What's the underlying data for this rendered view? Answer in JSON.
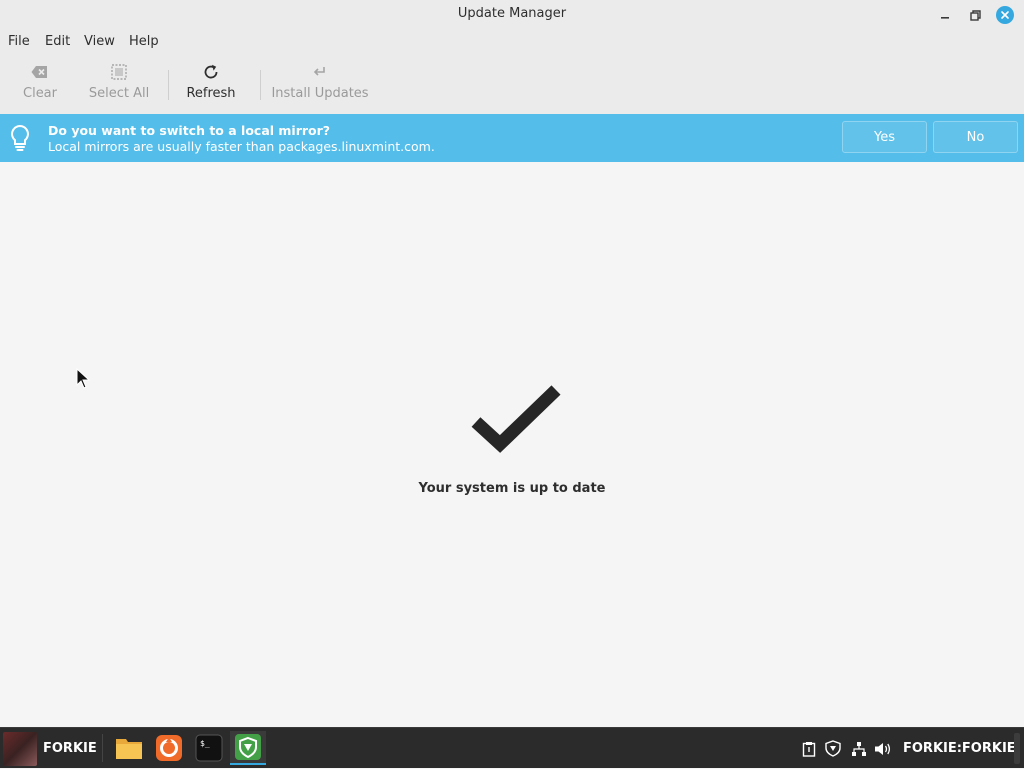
{
  "window": {
    "title": "Update Manager"
  },
  "menubar": {
    "items": [
      "File",
      "Edit",
      "View",
      "Help"
    ]
  },
  "toolbar": {
    "clear_label": "Clear",
    "select_all_label": "Select All",
    "refresh_label": "Refresh",
    "install_label": "Install Updates"
  },
  "infobar": {
    "title": "Do you want to switch to a local mirror?",
    "subtitle": "Local mirrors are usually faster than packages.linuxmint.com.",
    "yes_label": "Yes",
    "no_label": "No",
    "icon": "lightbulb-icon"
  },
  "content": {
    "status_icon": "checkmark-icon",
    "status_text": "Your system is up to date"
  },
  "taskbar": {
    "menu_label": "FORKIE",
    "apps": [
      "files-icon",
      "firefox-icon",
      "terminal-icon",
      "update-manager-icon"
    ],
    "tray_icons": [
      "clipboard-icon",
      "shield-icon",
      "network-icon",
      "volume-icon"
    ],
    "user_label": "FORKIE:FORKIE"
  },
  "colors": {
    "accent": "#35a8e0",
    "infobar_bg": "#55bde9",
    "taskbar_bg": "#2b2b2b",
    "window_bg": "#f5f5f5"
  }
}
